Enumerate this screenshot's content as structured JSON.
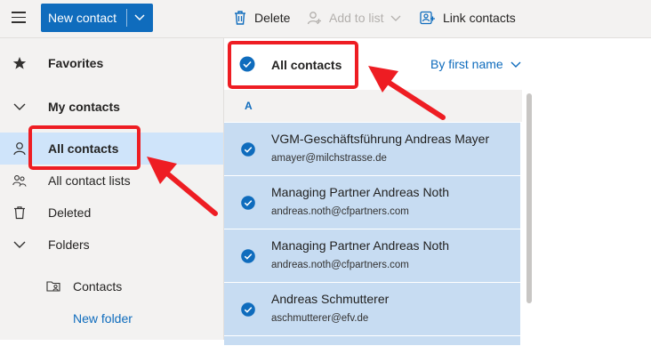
{
  "toolbar": {
    "new_contact_label": "New contact",
    "delete_label": "Delete",
    "add_to_list_label": "Add to list",
    "link_contacts_label": "Link contacts"
  },
  "nav": {
    "favorites": "Favorites",
    "my_contacts": "My contacts",
    "all_contacts": "All contacts",
    "all_contact_lists": "All contact lists",
    "deleted": "Deleted",
    "folders": "Folders",
    "contacts": "Contacts",
    "new_folder": "New folder"
  },
  "list": {
    "title": "All contacts",
    "sort_label": "By first name",
    "letter": "A",
    "contacts": [
      {
        "name": "VGM-Geschäftsführung Andreas Mayer",
        "email": "amayer@milchstrasse.de"
      },
      {
        "name": "Managing Partner Andreas Noth",
        "email": "andreas.noth@cfpartners.com"
      },
      {
        "name": "Managing Partner Andreas Noth",
        "email": "andreas.noth@cfpartners.com"
      },
      {
        "name": "Andreas Schmutterer",
        "email": "aschmutterer@efv.de"
      }
    ]
  },
  "colors": {
    "accent": "#0f6cbd",
    "selected_bg": "#c7dcf2",
    "annotation": "#ee1d23"
  }
}
